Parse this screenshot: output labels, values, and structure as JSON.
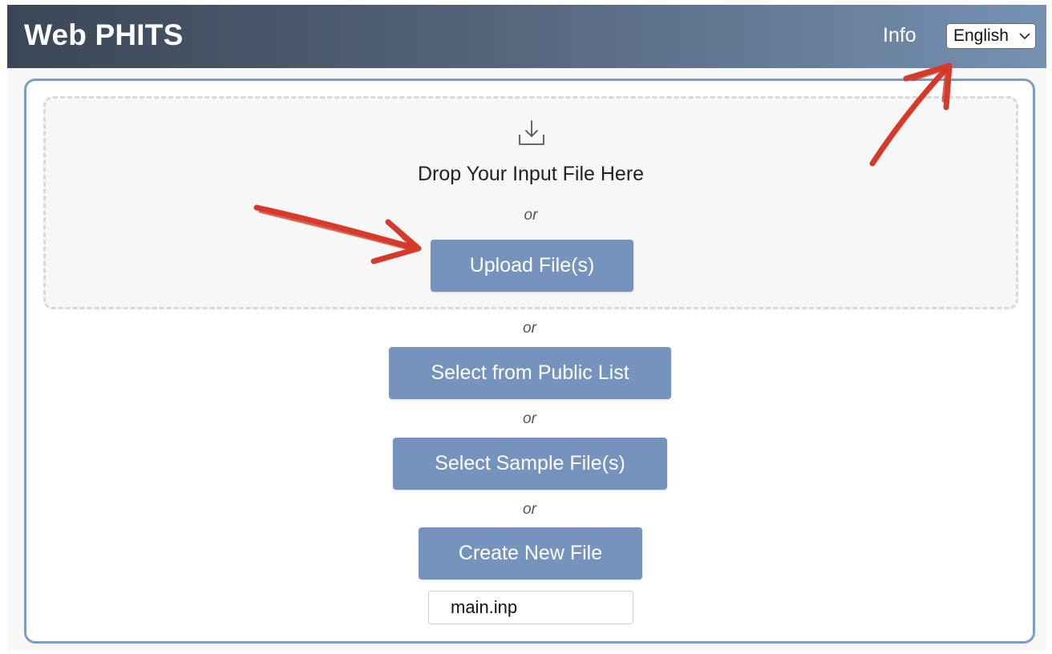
{
  "header": {
    "app_title": "Web PHITS",
    "info_label": "Info",
    "language": {
      "selected": "English"
    }
  },
  "dropzone": {
    "icon": "download-icon",
    "prompt": "Drop Your Input File Here",
    "or_label": "or",
    "upload_label": "Upload File(s)"
  },
  "separators": {
    "or_1": "or",
    "or_2": "or",
    "or_3": "or"
  },
  "actions": {
    "public_list_label": "Select from Public List",
    "sample_files_label": "Select Sample File(s)",
    "create_new_label": "Create New File"
  },
  "new_file": {
    "value": "main.inp"
  },
  "colors": {
    "button": "#7693bd",
    "card_border": "#7e9bc0",
    "annotation_arrow": "#d63a2a"
  }
}
